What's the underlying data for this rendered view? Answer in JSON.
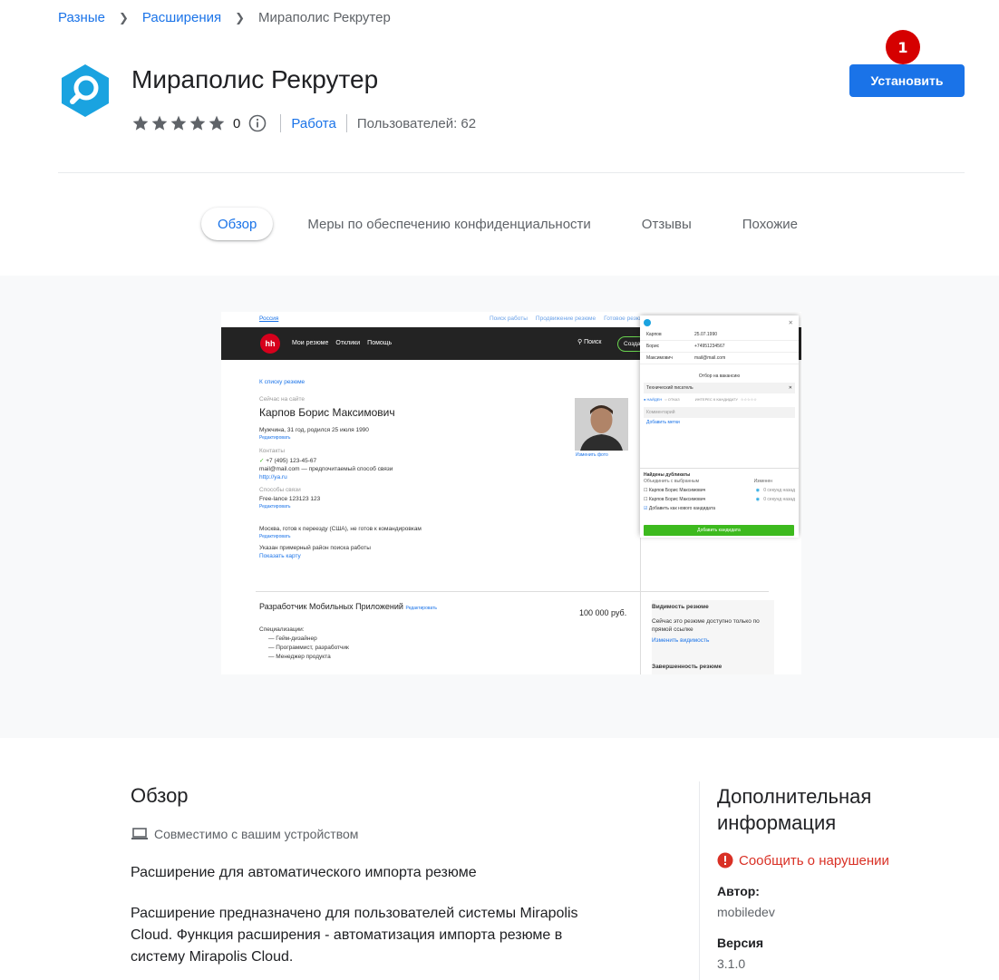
{
  "breadcrumb": {
    "items": [
      "Разные",
      "Расширения",
      "Мираполис Рекрутер"
    ]
  },
  "header": {
    "title": "Мираполис Рекрутер",
    "rating_value": 0,
    "rating_count": "0",
    "category": "Работа",
    "users": "Пользователей: 62",
    "install_label": "Установить",
    "notification_badge": "1",
    "accent_color": "#1a73e8",
    "badge_color": "#d50000"
  },
  "tabs": [
    {
      "label": "Обзор",
      "active": true
    },
    {
      "label": "Меры по обеспечению конфиденциальности",
      "active": false
    },
    {
      "label": "Отзывы",
      "active": false
    },
    {
      "label": "Похожие",
      "active": false
    }
  ],
  "screenshot": {
    "region": "Россия",
    "top_links": [
      "Поиск работы",
      "Продвижение резюме",
      "Готовое резюме"
    ],
    "logo": "hh",
    "nav": [
      "Мои резюме",
      "Отклики",
      "Помощь"
    ],
    "search": "Поиск",
    "create": "Созда",
    "back_link": "К списку резюме",
    "online": "Сейчас на сайте",
    "person_name": "Карпов Борис Максимович",
    "person_info": "Мужчина, 31 год, родился 25 июля 1990",
    "edit": "Редактировать",
    "contacts_label": "Контакты",
    "phone": "+7 (495) 123-45-67",
    "email": "mail@mail.com — предпочитаемый способ связи",
    "site": "http://ya.ru",
    "comm_label": "Способы связи",
    "comm_items": "Free-lance   123123   123",
    "relocation": "Москва, готов к переезду (США), не готов к командировкам",
    "area": "Указан примерный район поиска работы",
    "show_map": "Показать карту",
    "change_photo": "Изменить фото",
    "job_title": "Разработчик Мобильных Приложений",
    "salary": "100 000 руб.",
    "spec_label": "Специализации:",
    "specs": [
      "— Гейм-дизайнер",
      "— Программист, разработчик",
      "— Менеджер продукта"
    ],
    "visibility_title": "Видимость резюме",
    "visibility_text": "Сейчас это резюме доступно только по прямой ссылке",
    "change_visibility": "Изменить видимость",
    "completeness": "Завершенность резюме",
    "panel": {
      "fields": [
        [
          "Карпов",
          "25.07.1990"
        ],
        [
          "Борис",
          "+74951234567"
        ],
        [
          "Максимович",
          "mail@mail.com"
        ]
      ],
      "vacancy_label": "Отбор на вакансию",
      "vacancy": "Технический писатель",
      "stage_found": "НАЙДЕН",
      "stage_reject": "ОТКАЗ",
      "interest": "ИНТЕРЕС К КАНДИДАТУ",
      "comment": "Комментарий",
      "add_tags": "Добавить метки",
      "dup_title": "Найдены дубликаты",
      "merge": "Объединить с выбранным",
      "changed": "Изменен",
      "dups": [
        [
          "Карпов Борис Максимович",
          "0 секунд назад"
        ],
        [
          "Карпов Борис Максимович",
          "0 секунд назад"
        ]
      ],
      "add_new": "Добавить как нового кандидата",
      "add_btn": "Добавить кандидата"
    }
  },
  "overview": {
    "title": "Обзор",
    "compat": "Совместимо с вашим устройством",
    "short_desc": "Расширение для автоматического импорта резюме",
    "long_desc": "Расширение предназначено для пользователей системы Mirapolis Cloud. Функция расширения - автоматизация импорта резюме в систему Mirapolis Cloud."
  },
  "additional": {
    "title": "Дополнительная информация",
    "report": "Сообщить о нарушении",
    "author_label": "Автор:",
    "author": "mobiledev",
    "version_label": "Версия",
    "version": "3.1.0"
  }
}
